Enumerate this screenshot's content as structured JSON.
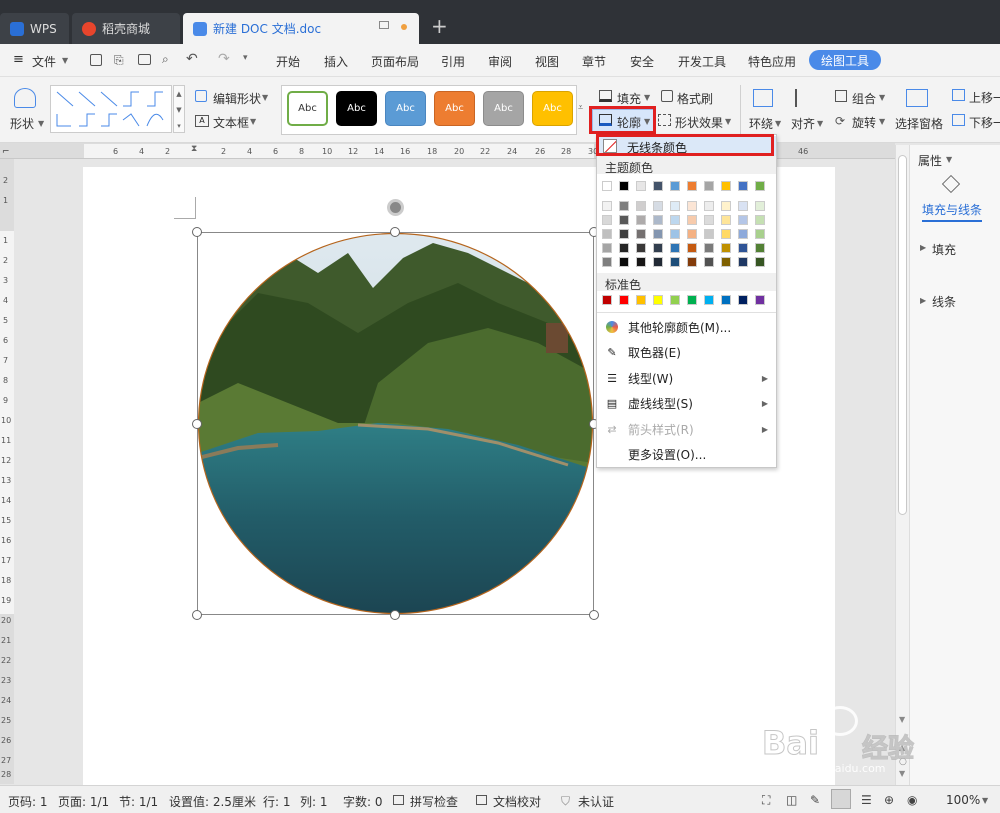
{
  "tabs": [
    {
      "label": "WPS"
    },
    {
      "label": "稻壳商城"
    },
    {
      "label": "新建 DOC 文档.doc"
    }
  ],
  "new_tab_symbol": "+",
  "menu": {
    "file": "文件",
    "items": [
      "开始",
      "插入",
      "页面布局",
      "引用",
      "审阅",
      "视图",
      "章节",
      "安全",
      "开发工具",
      "特色应用"
    ],
    "active": "绘图工具"
  },
  "ribbon": {
    "shape": "形状",
    "edit_shape": "编辑形状",
    "text_box": "文本框",
    "style_boxes": [
      {
        "text": "Abc",
        "bg": "#ffffff",
        "fg": "#333333",
        "border": "#70ad47"
      },
      {
        "text": "Abc",
        "bg": "#000000",
        "fg": "#ffffff",
        "border": "#000000"
      },
      {
        "text": "Abc",
        "bg": "#5b9bd5",
        "fg": "#ffffff",
        "border": "#4a86c0"
      },
      {
        "text": "Abc",
        "bg": "#ed7d31",
        "fg": "#ffffff",
        "border": "#c96524"
      },
      {
        "text": "Abc",
        "bg": "#a5a5a5",
        "fg": "#ffffff",
        "border": "#8c8c8c"
      },
      {
        "text": "Abc",
        "bg": "#ffc000",
        "fg": "#ffffff",
        "border": "#d9a300"
      }
    ],
    "fill": "填充",
    "format_painter": "格式刷",
    "outline": "轮廓",
    "shape_effect": "形状效果",
    "wrap": "环绕",
    "align": "对齐",
    "group": "组合",
    "rotate": "旋转",
    "select_pane": "选择窗格",
    "bring_forward": "上移一",
    "send_backward": "下移一"
  },
  "ruler": {
    "h_numbers": [
      "6",
      "4",
      "2",
      "2",
      "4",
      "6",
      "8",
      "10",
      "12",
      "14",
      "16",
      "18",
      "20",
      "22",
      "24",
      "26",
      "28",
      "30",
      "46"
    ],
    "v_numbers": [
      "2",
      "1",
      "1",
      "2",
      "3",
      "4",
      "5",
      "6",
      "7",
      "8",
      "9",
      "10",
      "11",
      "12",
      "13",
      "14",
      "15",
      "16",
      "17",
      "18",
      "19",
      "20",
      "21",
      "22",
      "23",
      "24",
      "25",
      "26",
      "27",
      "28"
    ]
  },
  "dropdown": {
    "no_line": "无线条颜色",
    "theme_colors_label": "主题颜色",
    "theme_top": [
      "#ffffff",
      "#000000",
      "#e7e6e6",
      "#44546a",
      "#5b9bd5",
      "#ed7d31",
      "#a5a5a5",
      "#ffc000",
      "#4472c4",
      "#70ad47"
    ],
    "theme_grid": [
      [
        "#f2f2f2",
        "#7f7f7f",
        "#d0cece",
        "#d6dce4",
        "#deebf6",
        "#fbe5d5",
        "#ededed",
        "#fff2cc",
        "#d9e2f3",
        "#e2efd9"
      ],
      [
        "#d8d8d8",
        "#595959",
        "#aeabab",
        "#adb9ca",
        "#bdd7ee",
        "#f7cbac",
        "#dbdbdb",
        "#fee599",
        "#b4c6e7",
        "#c5e0b3"
      ],
      [
        "#bfbfbf",
        "#3f3f3f",
        "#757070",
        "#8496b0",
        "#9dc3e6",
        "#f4b183",
        "#c9c9c9",
        "#ffd965",
        "#8eaadb",
        "#a8d08d"
      ],
      [
        "#a5a5a5",
        "#262626",
        "#3a3838",
        "#323f4f",
        "#2e75b5",
        "#c55a11",
        "#7b7b7b",
        "#bf9000",
        "#2f5496",
        "#538135"
      ],
      [
        "#7f7f7f",
        "#0c0c0c",
        "#171616",
        "#222a35",
        "#1e4e79",
        "#833c0b",
        "#525252",
        "#7f6000",
        "#1f3864",
        "#375623"
      ]
    ],
    "standard_label": "标准色",
    "standard": [
      "#c00000",
      "#ff0000",
      "#ffc000",
      "#ffff00",
      "#92d050",
      "#00b050",
      "#00b0f0",
      "#0070c0",
      "#002060",
      "#7030a0"
    ],
    "more_colors": "其他轮廓颜色(M)...",
    "eyedropper": "取色器(E)",
    "line_type": "线型(W)",
    "dash_type": "虚线线型(S)",
    "arrow_style": "箭头样式(R)",
    "more_settings": "更多设置(O)..."
  },
  "right_panel": {
    "title": "属性",
    "tab": "填充与线条",
    "fill": "填充",
    "line": "线条"
  },
  "status": {
    "page_code": "页码: 1",
    "page": "页面: 1/1",
    "section": "节: 1/1",
    "setting": "设置值: 2.5厘米",
    "row": "行: 1",
    "col": "列: 1",
    "words": "字数: 0",
    "spell": "拼写检查",
    "proof": "文档校对",
    "cert": "未认证",
    "zoom": "100%"
  },
  "watermark": {
    "brand": "Bai",
    "brand2": "经验",
    "url": "jingyan.baidu.com"
  }
}
